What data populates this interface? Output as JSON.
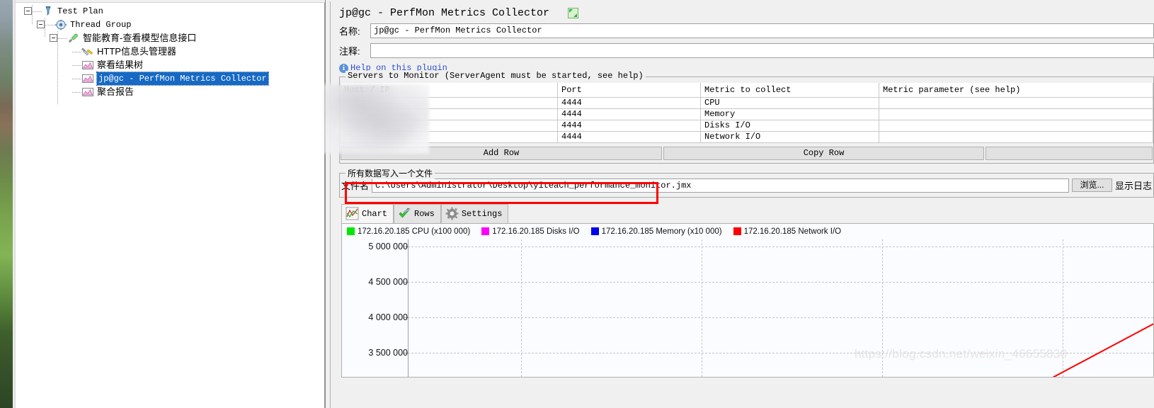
{
  "tree": {
    "items": [
      {
        "label": "Test Plan",
        "icon": "test-plan-icon",
        "depth": 0,
        "selected": false,
        "cjk": false
      },
      {
        "label": "Thread Group",
        "icon": "thread-group-icon",
        "depth": 1,
        "selected": false,
        "cjk": false
      },
      {
        "label": "智能教育-查看模型信息接口",
        "icon": "http-request-icon",
        "depth": 2,
        "selected": false,
        "cjk": true
      },
      {
        "label": "HTTP信息头管理器",
        "icon": "header-manager-icon",
        "depth": 3,
        "selected": false,
        "cjk": true
      },
      {
        "label": "察看结果树",
        "icon": "listener-icon",
        "depth": 3,
        "selected": false,
        "cjk": true
      },
      {
        "label": "jp@gc - PerfMon Metrics Collector",
        "icon": "listener-icon",
        "depth": 3,
        "selected": true,
        "cjk": false
      },
      {
        "label": "聚合报告",
        "icon": "listener-icon",
        "depth": 3,
        "selected": false,
        "cjk": true
      }
    ]
  },
  "editor": {
    "panel_title": "jp@gc - PerfMon Metrics Collector",
    "maximize_icon": "maximize-icon",
    "name_label": "名称:",
    "name_value": "jp@gc - PerfMon Metrics Collector",
    "comment_label": "注释:",
    "comment_value": "",
    "help_link": "Help on this plugin",
    "info_icon": "info-icon"
  },
  "servers": {
    "group_title": "Servers to Monitor (ServerAgent must be started, see help)",
    "columns": [
      "Host / IP",
      "Port",
      "Metric to collect",
      "Metric parameter (see help)"
    ],
    "rows": [
      {
        "host": "",
        "port": "4444",
        "metric": "CPU",
        "param": ""
      },
      {
        "host": "",
        "port": "4444",
        "metric": "Memory",
        "param": ""
      },
      {
        "host": "",
        "port": "4444",
        "metric": "Disks I/O",
        "param": ""
      },
      {
        "host": "",
        "port": "4444",
        "metric": "Network I/O",
        "param": ""
      }
    ],
    "add_row_label": "Add Row",
    "copy_row_label": "Copy Row",
    "delete_row_label": ""
  },
  "file_group": {
    "title": "所有数据写入一个文件",
    "file_label": "文件名",
    "file_value": "C:\\Users\\Administrator\\Desktop\\yiteach_performance_monitor.jmx",
    "browse_label": "浏览...",
    "show_log_label": "显示日志"
  },
  "tabs": [
    {
      "label": "Chart",
      "icon": "chart-icon",
      "active": true
    },
    {
      "label": "Rows",
      "icon": "check-icon",
      "active": false
    },
    {
      "label": "Settings",
      "icon": "gear-icon",
      "active": false
    }
  ],
  "chart_data": {
    "type": "line",
    "title": "",
    "xlabel": "",
    "ylabel": "",
    "ylim": [
      3250000,
      5125000
    ],
    "yticks": [
      5000000,
      4500000,
      4000000,
      3500000
    ],
    "ytick_labels": [
      "5 000 000",
      "4 500 000",
      "4 000 000",
      "3 500 000"
    ],
    "grid": true,
    "legend_position": "top",
    "series": [
      {
        "name": "172.16.20.185 CPU (x100 000)",
        "color": "#00e800",
        "values": []
      },
      {
        "name": "172.16.20.185 Disks I/O",
        "color": "#ff00ff",
        "values": []
      },
      {
        "name": "172.16.20.185 Memory (x10 000)",
        "color": "#0000ee",
        "values": []
      },
      {
        "name": "172.16.20.185 Network I/O",
        "color": "#ff0000",
        "values": []
      }
    ],
    "annotations": [
      "https://blog.csdn.net/weixin_46655830"
    ]
  },
  "watermark": "https://blog.csdn.net/weixin_46655830"
}
